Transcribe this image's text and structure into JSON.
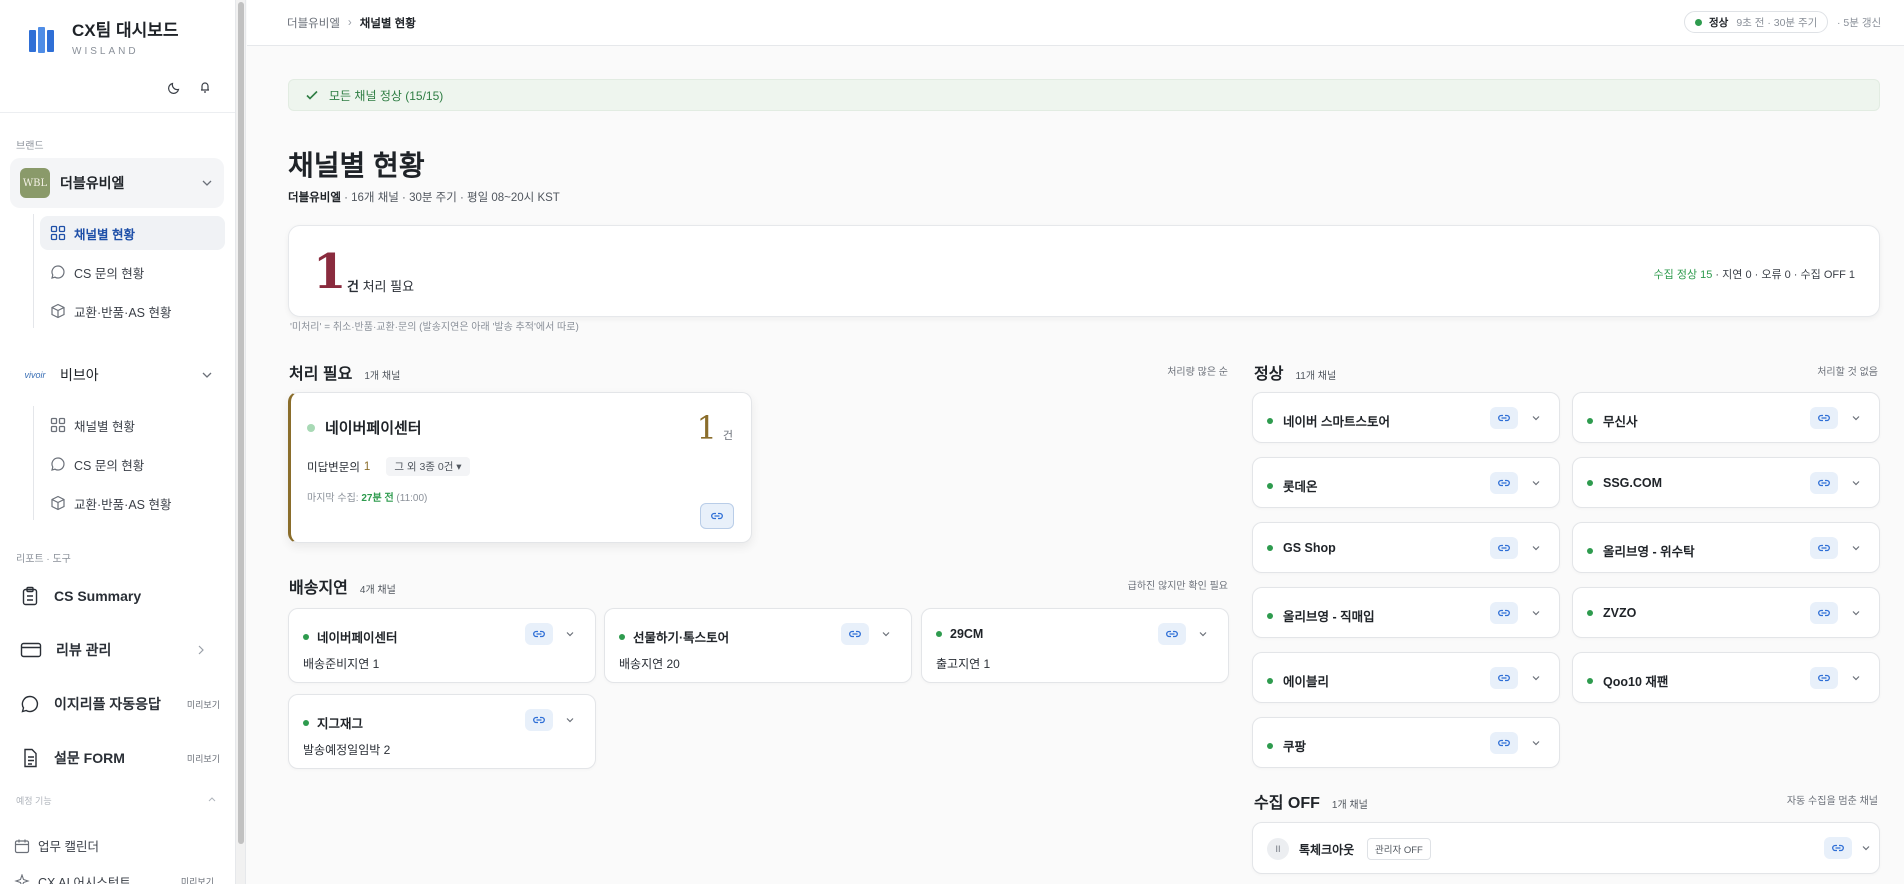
{
  "app": {
    "title": "CX팀 대시보드",
    "subtitle": "WISLAND"
  },
  "sidebar": {
    "brand_section_label": "브랜드",
    "brands": [
      {
        "name": "더블유비엘",
        "logo_text": "WBL",
        "items": [
          {
            "label": "채널별 현황",
            "icon": "grid-icon"
          },
          {
            "label": "CS 문의 현황",
            "icon": "chat-icon"
          },
          {
            "label": "교환·반품·AS 현황",
            "icon": "box-icon"
          }
        ]
      },
      {
        "name": "비브아",
        "logo_text": "vivoir",
        "items": [
          {
            "label": "채널별 현황",
            "icon": "grid-icon"
          },
          {
            "label": "CS 문의 현황",
            "icon": "chat-icon"
          },
          {
            "label": "교환·반품·AS 현황",
            "icon": "box-icon"
          }
        ]
      }
    ],
    "tools_section_label": "리포트 · 도구",
    "tools": [
      {
        "label": "CS Summary",
        "badge": ""
      },
      {
        "label": "리뷰 관리",
        "badge": ""
      },
      {
        "label": "이지리플 자동응답",
        "badge": "미리보기"
      },
      {
        "label": "설문 FORM",
        "badge": "미리보기"
      }
    ],
    "planned_section_label": "예정 기능",
    "planned": [
      {
        "label": "업무 캘린더",
        "badge": ""
      },
      {
        "label": "CX AI 어시스턴트",
        "badge": "미리보기"
      }
    ]
  },
  "topbar": {
    "breadcrumb": [
      "더블유비엘",
      "채널별 현황"
    ],
    "status_label": "정상",
    "status_meta": "9초 전 · 30분 주기",
    "refresh": "· 5분 갱신"
  },
  "alert": "모든 채널 정상 (15/15)",
  "page": {
    "title": "채널별 현황",
    "subtitle_brand": "더블유비엘",
    "subtitle_rest": " · 16개 채널 · 30분 주기 · 평일 08~20시 KST"
  },
  "summary": {
    "count": "1",
    "label_bold": "건",
    "label_rest": " 처리 필요",
    "right_ok": "수집 정상 15",
    "right_rest": " · 지연 0 · 오류 0 · 수집 OFF 1",
    "note": "'미처리' = 취소·반품·교환·문의 (발송지연은 아래 '발송 추적'에서 따로)"
  },
  "needs_action": {
    "title": "처리 필요",
    "count": "1개 채널",
    "hint": "처리량 많은 순",
    "card": {
      "name": "네이버페이센터",
      "count": "1",
      "unit": "건",
      "row_label": "미답변문의",
      "row_value": "1",
      "more": "그 외 3종 0건 ▾",
      "last_label": "마지막 수집: ",
      "last_value": "27분 전",
      "last_time": " (11:00)"
    }
  },
  "delay": {
    "title": "배송지연",
    "count": "4개 채널",
    "hint": "급하진 않지만 확인 필요",
    "cards": [
      {
        "name": "네이버페이센터",
        "value": "배송준비지연  1"
      },
      {
        "name": "선물하기·톡스토어",
        "value": "배송지연  20"
      },
      {
        "name": "29CM",
        "value": "출고지연  1"
      },
      {
        "name": "지그재그",
        "value": "발송예정일임박  2"
      }
    ]
  },
  "normal": {
    "title": "정상",
    "count": "11개 채널",
    "hint": "처리할 것 없음",
    "left": [
      "네이버 스마트스토어",
      "롯데온",
      "GS Shop",
      "올리브영 - 직매입",
      "에이블리",
      "쿠팡"
    ],
    "right": [
      "무신사",
      "SSG.COM",
      "올리브영 - 위수탁",
      "ZVZO",
      "Qoo10 재팬"
    ]
  },
  "off": {
    "title": "수집 OFF",
    "count": "1개 채널",
    "hint": "자동 수집을 멈춘 채널",
    "card": {
      "pause": "II",
      "name": "톡체크아웃",
      "tag": "관리자 OFF"
    }
  },
  "colors": {
    "accent": "#1e4fa8",
    "ok": "#2e9b4e",
    "danger": "#8a2b3e",
    "warn": "#8a6d2b"
  }
}
